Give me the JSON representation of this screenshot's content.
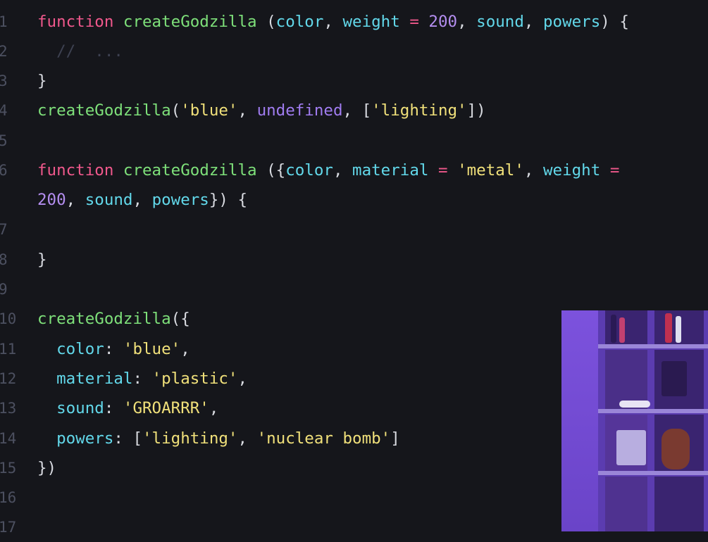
{
  "editor": {
    "lines": [
      {
        "n": "1",
        "tokens": [
          [
            "kw",
            "function "
          ],
          [
            "fn",
            "createGodzilla "
          ],
          [
            "punc",
            "("
          ],
          [
            "pm",
            "color"
          ],
          [
            "punc",
            ", "
          ],
          [
            "pm",
            "weight "
          ],
          [
            "op",
            "= "
          ],
          [
            "num",
            "200"
          ],
          [
            "punc",
            ", "
          ],
          [
            "pm",
            "sound"
          ],
          [
            "punc",
            ", "
          ],
          [
            "pm",
            "powers"
          ],
          [
            "punc",
            ") {"
          ]
        ]
      },
      {
        "n": "2",
        "tokens": [
          [
            "cmt",
            "  //  ..."
          ]
        ]
      },
      {
        "n": "3",
        "tokens": [
          [
            "punc",
            "}"
          ]
        ]
      },
      {
        "n": "4",
        "tokens": [
          [
            "fn",
            "createGodzilla"
          ],
          [
            "punc",
            "("
          ],
          [
            "str",
            "'blue'"
          ],
          [
            "punc",
            ", "
          ],
          [
            "und",
            "undefined"
          ],
          [
            "punc",
            ", ["
          ],
          [
            "str",
            "'lighting'"
          ],
          [
            "punc",
            "])"
          ]
        ]
      },
      {
        "n": "5",
        "tokens": []
      },
      {
        "n": "6",
        "tokens": [
          [
            "kw",
            "function "
          ],
          [
            "fn",
            "createGodzilla "
          ],
          [
            "punc",
            "({"
          ],
          [
            "pm",
            "color"
          ],
          [
            "punc",
            ", "
          ],
          [
            "pm",
            "material "
          ],
          [
            "op",
            "= "
          ],
          [
            "str",
            "'metal'"
          ],
          [
            "punc",
            ", "
          ],
          [
            "pm",
            "weight "
          ],
          [
            "op",
            "="
          ]
        ]
      },
      {
        "n": "",
        "tokens": [
          [
            "num",
            "200"
          ],
          [
            "punc",
            ", "
          ],
          [
            "pm",
            "sound"
          ],
          [
            "punc",
            ", "
          ],
          [
            "pm",
            "powers"
          ],
          [
            "punc",
            "}) {"
          ]
        ]
      },
      {
        "n": "7",
        "tokens": []
      },
      {
        "n": "8",
        "tokens": [
          [
            "punc",
            "}"
          ]
        ]
      },
      {
        "n": "9",
        "tokens": []
      },
      {
        "n": "10",
        "tokens": [
          [
            "fn",
            "createGodzilla"
          ],
          [
            "punc",
            "({"
          ]
        ]
      },
      {
        "n": "11",
        "tokens": [
          [
            "pm",
            "  color"
          ],
          [
            "punc",
            ": "
          ],
          [
            "str",
            "'blue'"
          ],
          [
            "punc",
            ","
          ]
        ]
      },
      {
        "n": "12",
        "tokens": [
          [
            "pm",
            "  material"
          ],
          [
            "punc",
            ": "
          ],
          [
            "str",
            "'plastic'"
          ],
          [
            "punc",
            ","
          ]
        ]
      },
      {
        "n": "13",
        "tokens": [
          [
            "pm",
            "  sound"
          ],
          [
            "punc",
            ": "
          ],
          [
            "str",
            "'GROARRR'"
          ],
          [
            "punc",
            ","
          ]
        ]
      },
      {
        "n": "14",
        "tokens": [
          [
            "pm",
            "  powers"
          ],
          [
            "punc",
            ": ["
          ],
          [
            "str",
            "'lighting'"
          ],
          [
            "punc",
            ", "
          ],
          [
            "str",
            "'nuclear bomb'"
          ],
          [
            "punc",
            "]"
          ]
        ]
      },
      {
        "n": "15",
        "tokens": [
          [
            "punc",
            "})"
          ]
        ]
      },
      {
        "n": "16",
        "tokens": []
      },
      {
        "n": "17",
        "tokens": []
      }
    ]
  },
  "colors": {
    "background": "#15161b",
    "keyword": "#f0588c",
    "function": "#7ee07a",
    "param": "#62d8ea",
    "string": "#f0e07a",
    "number": "#b48ef0"
  },
  "webcam": {
    "label": "presenter webcam overlay"
  }
}
